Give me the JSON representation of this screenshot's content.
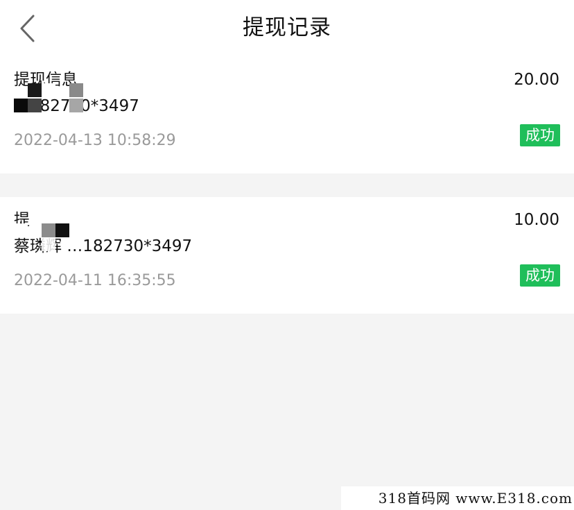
{
  "header": {
    "title": "提现记录",
    "back_icon": "chevron-left-icon"
  },
  "records": [
    {
      "label": "提现信息",
      "account": "…182730*3497",
      "amount": "20.00",
      "time": "2022-04-13 10:58:29",
      "status": "成功"
    },
    {
      "label": "提",
      "account": "蔡璘辉 …182730*3497",
      "amount": "10.00",
      "time": "2022-04-11 16:35:55",
      "status": "成功"
    }
  ],
  "watermark": "318首码网 www.E318.com",
  "colors": {
    "status_green": "#1fbe5a",
    "page_background": "#f4f4f4",
    "time_gray": "#9a9a9a"
  }
}
